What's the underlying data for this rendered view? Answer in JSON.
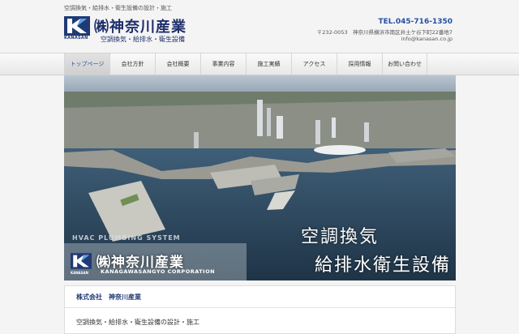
{
  "header": {
    "tagline": "空調換気・給排水・衛生設備の設計・施工",
    "logo_text": "KANASAN",
    "company_name": "㈱神奈川産業",
    "company_desc": "空調換気・給排水・衛生設備",
    "tel": "TEL.045-716-1350",
    "address": "〒232-0053　神奈川県横浜市南区井土ケ谷下町22番地7",
    "email": "info@kanasan.co.jp"
  },
  "nav": {
    "items": [
      {
        "label": "トップページ",
        "active": true
      },
      {
        "label": "会社方針"
      },
      {
        "label": "会社概要"
      },
      {
        "label": "事業内容"
      },
      {
        "label": "施工実績"
      },
      {
        "label": "アクセス"
      },
      {
        "label": "採用情報"
      },
      {
        "label": "お問い合わせ"
      }
    ]
  },
  "hero": {
    "catch_line1": "空調換気",
    "catch_line2": "給排水衛生設備",
    "english_text": "HVAC PLUMBING SYSTEM",
    "logo_text": "KANASAN",
    "company_name": "㈱神奈川産業",
    "company_name_en": "KANAGAWASANGYO CORPORATION"
  },
  "content": {
    "title": "株式会社　神奈川産業",
    "body": "空調換気・給排水・衛生設備の設計・施工"
  },
  "colors": {
    "brand_navy": "#1f2f6b",
    "accent_blue": "#2450a6"
  }
}
